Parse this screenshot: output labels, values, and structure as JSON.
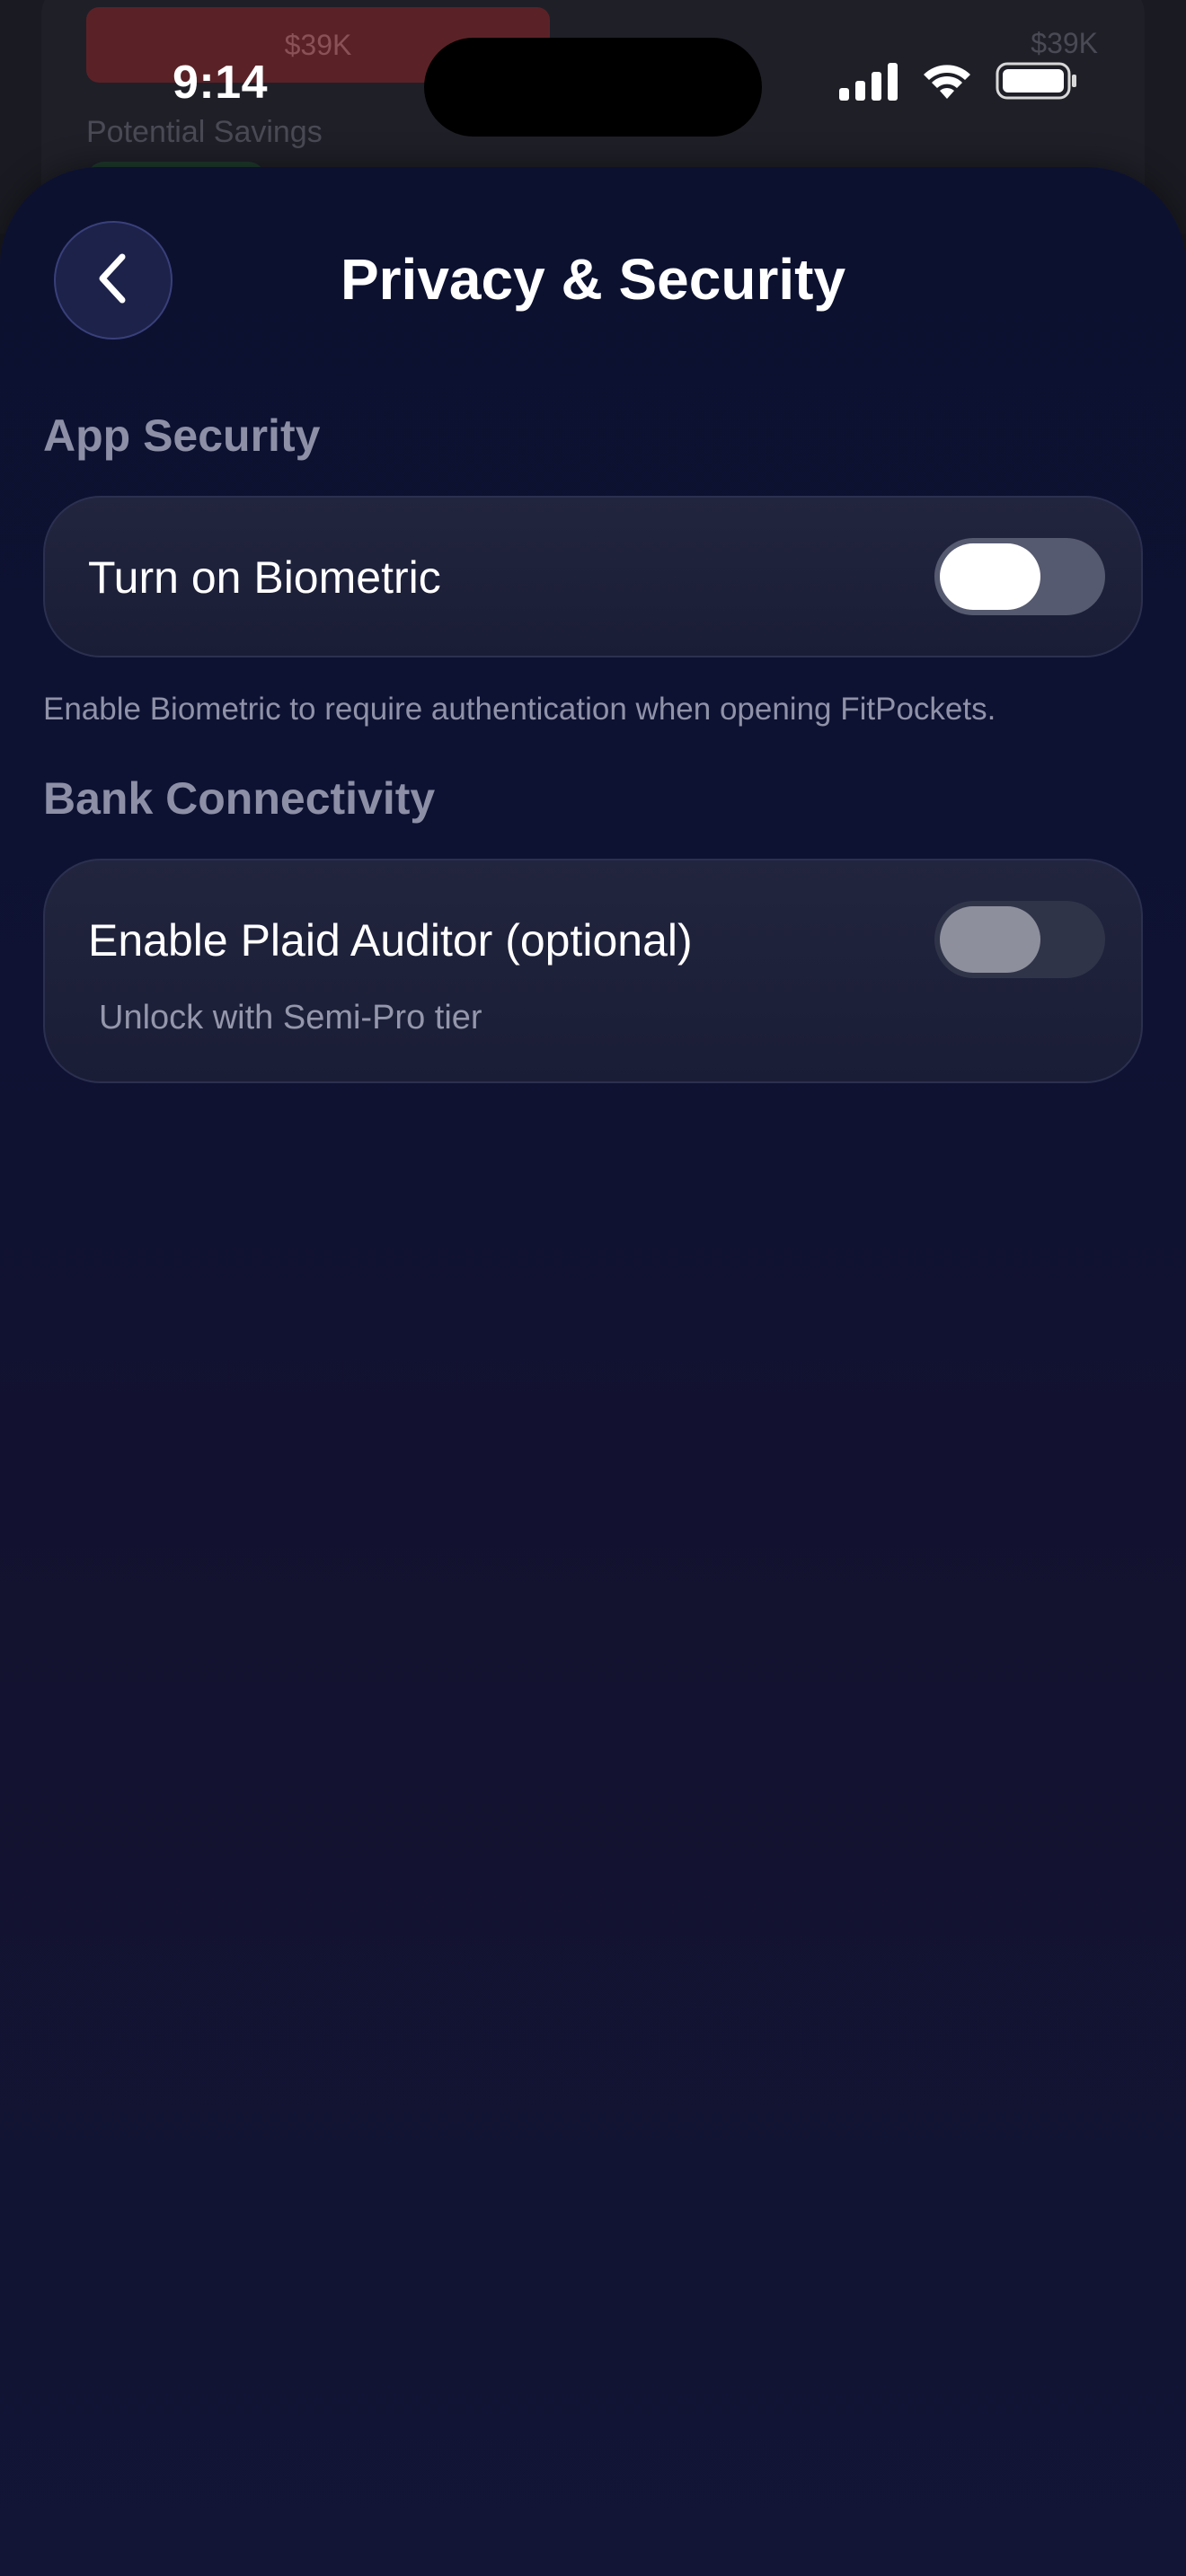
{
  "background_app": {
    "bar_value": "$39K",
    "right_value": "$39K",
    "label": "Potential Savings"
  },
  "status_bar": {
    "time": "9:14",
    "icons": [
      "cellular-signal-icon",
      "wifi-icon",
      "battery-icon"
    ]
  },
  "header": {
    "title": "Privacy & Security",
    "back_icon": "chevron-left-icon"
  },
  "sections": {
    "app_security": {
      "title": "App Security",
      "item_label": "Turn on Biometric",
      "toggle_on": true,
      "footnote": "Enable Biometric to require authentication when opening FitPockets."
    },
    "bank_connectivity": {
      "title": "Bank Connectivity",
      "item_label": "Enable Plaid Auditor (optional)",
      "item_sublabel": "Unlock with Semi-Pro tier",
      "toggle_on": false,
      "toggle_disabled": true
    }
  },
  "colors": {
    "sheet_top": "#0c1130",
    "sheet_bottom": "#121536",
    "card": "#1e2139",
    "accent_red_bg": "#5a2227"
  }
}
